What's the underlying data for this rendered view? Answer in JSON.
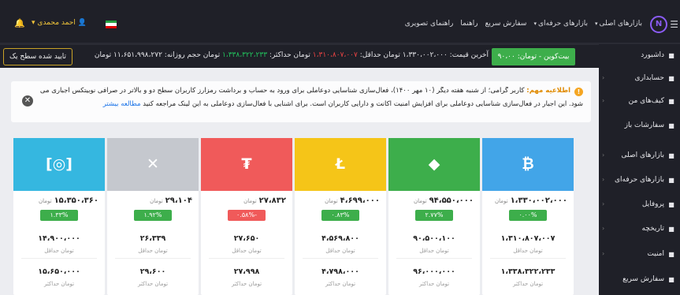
{
  "topbar": {
    "menu_icon": "hamburger-icon",
    "nav": [
      {
        "label": "بازارهای اصلی",
        "caret": "▾"
      },
      {
        "label": "بازارهای حرفه‌ای",
        "caret": "▾"
      },
      {
        "label": "سفارش سریع",
        "caret": ""
      },
      {
        "label": "راهنما",
        "caret": ""
      },
      {
        "label": "راهنمای تصویری",
        "caret": ""
      }
    ],
    "user_name": "احمد محمدی",
    "user_caret": "▾",
    "bell_icon": "bell-icon"
  },
  "sidebar": {
    "items": [
      {
        "label": "داشبورد",
        "icon": "■",
        "arrow": ""
      },
      {
        "label": "حسابداری",
        "icon": "■",
        "arrow": "‹"
      },
      {
        "label": "کیف‌های من",
        "icon": "■",
        "arrow": "‹"
      },
      {
        "label": "سفارشات باز",
        "icon": "■",
        "arrow": ""
      },
      {
        "label": "بازارهای اصلی",
        "icon": "■",
        "arrow": "‹"
      },
      {
        "label": "بازارهای حرفه‌ای",
        "icon": "■",
        "arrow": "‹"
      },
      {
        "label": "پروفایل",
        "icon": "■",
        "arrow": "‹"
      },
      {
        "label": "تاریخچه",
        "icon": "■",
        "arrow": "‹"
      },
      {
        "label": "امنیت",
        "icon": "■",
        "arrow": "‹"
      },
      {
        "label": "سفارش سریع",
        "icon": "■",
        "arrow": ""
      }
    ]
  },
  "pricebar": {
    "ticker": "بیت‌کوین - تومان: ۹۰،۰۰",
    "last_price_label": "آخرین قیمت:",
    "last_price": "۱،۳۳۰،۰۰۲،۰۰۰ تومان",
    "min_label": "حداقل:",
    "min_value": "۱،۳۱۰،۸۰۷،۰۰۷",
    "max_label": "تومان حداکثر:",
    "max_value": "۱،۳۳۸،۳۲۲،۲۳۳",
    "volume_label": "تومان حجم روزانه:",
    "volume_value": "۱۱،۶۵۱،۹۹۸،۲۷۲ تومان",
    "verify_button": "تایید شده سطح یک"
  },
  "alert": {
    "title": "اطلاعیه مهم:",
    "line1": "کاربر گرامی؛ از شنبه هفته دیگر (۱۰ مهر ۱۴۰۰)، فعال‌سازی شناسایی دوعاملی برای ورود به حساب و برداشت رمزارز کاربران سطح دو و بالاتر در صرافی نوبیتکس اجباری می",
    "line2": "شود. این اجبار در فعال‌سازی شناسایی دوعاملی برای افزایش امنیت اکانت و دارایی کاربران است. برای آشنایی با فعال‌سازی دوعاملی به این لینک مراجعه کنید",
    "link": "مطالعه بیشتر"
  },
  "cards": [
    {
      "name": "bitcoin",
      "symbol": "₿",
      "color": "#42a5e8",
      "price": "۱،۳۳۰،۰۰۲،۰۰۰",
      "unit": "تومان",
      "change": "۰.۰۰%",
      "change_color": "#3dae4b",
      "v1": "۱،۳۱۰،۸۰۷،۰۰۷",
      "l1": "تومان حداقل",
      "v2": "۱،۳۳۸،۳۲۲،۲۳۳",
      "l2": "تومان حداکثر"
    },
    {
      "name": "ethereum",
      "symbol": "◆",
      "color": "#3dae4b",
      "price": "۹۴،۵۵۰،۰۰۰",
      "unit": "تومان",
      "change": "۲.۷۷%",
      "change_color": "#3dae4b",
      "v1": "۹۰،۵۰۰،۱۰۰",
      "l1": "تومان حداقل",
      "v2": "۹۶،۰۰۰،۰۰۰",
      "l2": "تومان حداکثر"
    },
    {
      "name": "litecoin",
      "symbol": "Ł",
      "color": "#f5c518",
      "price": "۴،۶۹۹،۰۰۰",
      "unit": "تومان",
      "change": "۰.۸۳%",
      "change_color": "#3dae4b",
      "v1": "۴،۵۶۹،۸۰۰",
      "l1": "تومان حداقل",
      "v2": "۴،۷۹۸،۰۰۰",
      "l2": "تومان حداکثر"
    },
    {
      "name": "tether",
      "symbol": "₮",
      "color": "#f05a5a",
      "price": "۲۷،۸۳۲",
      "unit": "تومان",
      "change": "-۰.۵۸%",
      "change_color": "#f05a5a",
      "v1": "۲۷،۶۵۰",
      "l1": "تومان حداقل",
      "v2": "۲۷،۹۹۸",
      "l2": "تومان حداکثر"
    },
    {
      "name": "ripple",
      "symbol": "✕",
      "color": "#c5c8ce",
      "price": "۲۹،۱۰۴",
      "unit": "تومان",
      "change": "۱.۹۲%",
      "change_color": "#3dae4b",
      "v1": "۲۶،۳۳۹",
      "l1": "تومان حداقل",
      "v2": "۲۹،۶۰۰",
      "l2": "تومان حداکثر"
    },
    {
      "name": "bitcoin-cash",
      "symbol": "[◎]",
      "color": "#35b7e0",
      "price": "۱۵،۳۵۰،۳۶۰",
      "unit": "تومان",
      "change": "۱.۳۳%",
      "change_color": "#3dae4b",
      "v1": "۱۴،۹۰۰،۰۰۰",
      "l1": "تومان حداقل",
      "v2": "۱۵،۶۵۰،۰۰۰",
      "l2": "تومان حداکثر"
    }
  ]
}
